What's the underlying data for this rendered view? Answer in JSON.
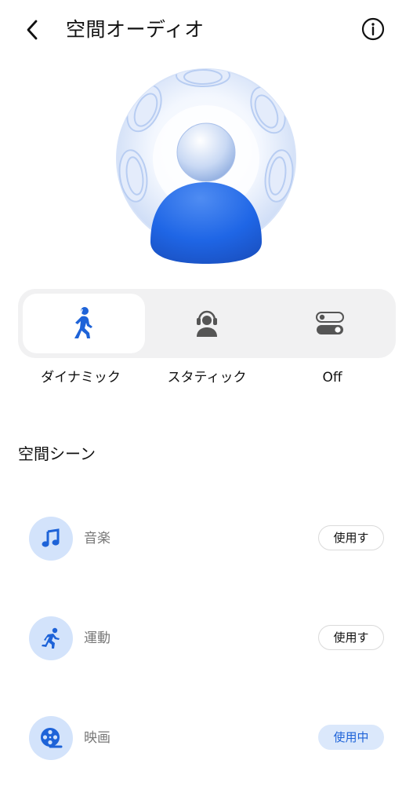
{
  "header": {
    "title": "空間オーディオ",
    "back_icon": "chevron-left-icon",
    "info_icon": "info-circle-icon"
  },
  "hero": {
    "icon": "spatial-audio-person-sphere-illustration"
  },
  "modes": [
    {
      "label": "ダイナミック",
      "icon": "walking-person-icon",
      "selected": true
    },
    {
      "label": "スタティック",
      "icon": "headphones-person-icon",
      "selected": false
    },
    {
      "label": "Off",
      "icon": "toggle-switches-icon",
      "selected": false
    }
  ],
  "scenes": {
    "title": "空間シーン",
    "items": [
      {
        "label": "音楽",
        "icon": "music-note-icon",
        "button": "使用す",
        "active": false
      },
      {
        "label": "運動",
        "icon": "running-person-icon",
        "button": "使用す",
        "active": false
      },
      {
        "label": "映画",
        "icon": "film-reel-icon",
        "button": "使用中",
        "active": true
      }
    ]
  },
  "colors": {
    "accent": "#1e63d8",
    "icon_bg": "#d3e3fb",
    "segment_bg": "#f1f1f2",
    "active_button_bg": "#dbe8fb"
  }
}
